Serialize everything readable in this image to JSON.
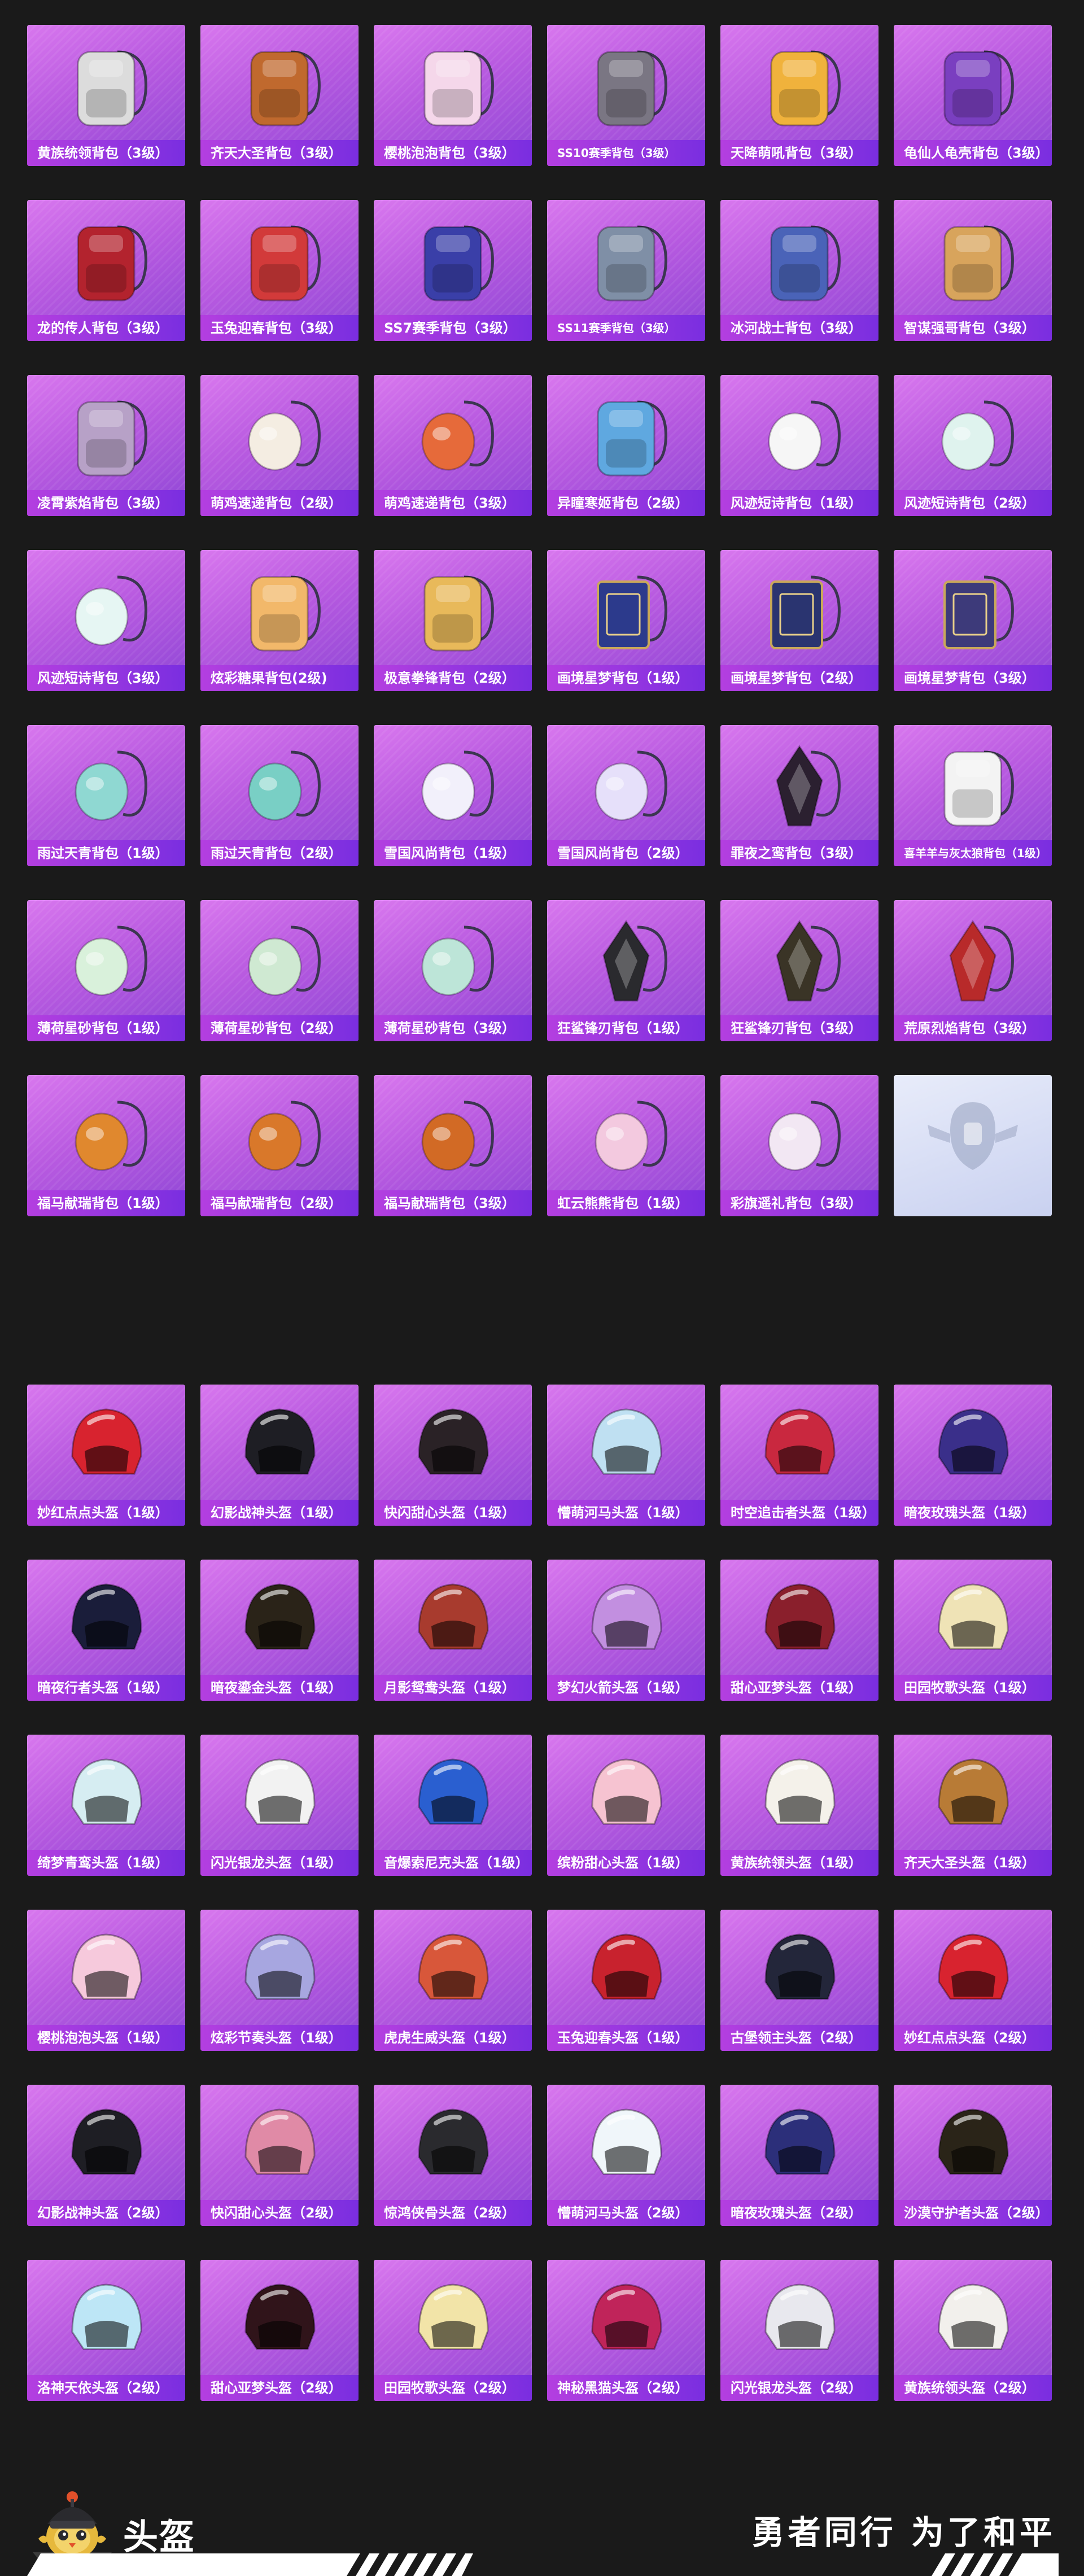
{
  "backpacks": [
    {
      "name": "黄族统领背包（3级）",
      "icon": "backpack-ornate-silver-icon",
      "color": "#dcdcdc"
    },
    {
      "name": "齐天大圣背包（3级）",
      "icon": "backpack-monkey-king-icon",
      "color": "#c0692e"
    },
    {
      "name": "樱桃泡泡背包（3级）",
      "icon": "backpack-bow-icon",
      "color": "#f5d7ea"
    },
    {
      "name": "SS10赛季背包（3级）",
      "icon": "backpack-icon",
      "color": "#7a7683"
    },
    {
      "name": "天降萌吼背包（3级）",
      "icon": "backpack-icon",
      "color": "#f0b23c"
    },
    {
      "name": "龟仙人龟壳背包（3级）",
      "icon": "backpack-turtle-shell-icon",
      "color": "#7a3fc0"
    },
    {
      "name": "龙的传人背包（3级）",
      "icon": "backpack-icon",
      "color": "#b3232e"
    },
    {
      "name": "玉兔迎春背包（3级）",
      "icon": "backpack-icon",
      "color": "#d23a3a"
    },
    {
      "name": "SS7赛季背包（3级）",
      "icon": "backpack-icon",
      "color": "#3a3fa8"
    },
    {
      "name": "SS11赛季背包（3级）",
      "icon": "backpack-icon",
      "color": "#7f8fa6"
    },
    {
      "name": "冰河战士背包（3级）",
      "icon": "backpack-icon",
      "color": "#4a63b8"
    },
    {
      "name": "智谋强哥背包（3级）",
      "icon": "backpack-plush-icon",
      "color": "#d8a45c"
    },
    {
      "name": "凌霄紫焰背包（3级）",
      "icon": "backpack-ornate-icon",
      "color": "#b7a1c7"
    },
    {
      "name": "萌鸡速递背包（2级）",
      "icon": "backpack-chick-icon",
      "color": "#f4ede2"
    },
    {
      "name": "萌鸡速递背包（3级）",
      "icon": "backpack-chick-icon",
      "color": "#e66a3a"
    },
    {
      "name": "异瞳寒姬背包（2级）",
      "icon": "backpack-plush-icon",
      "color": "#5fa8e0"
    },
    {
      "name": "风迹短诗背包（1级）",
      "icon": "backpack-sling-icon",
      "color": "#f6f6f6"
    },
    {
      "name": "风迹短诗背包（2级）",
      "icon": "backpack-sling-icon",
      "color": "#dff3ee"
    },
    {
      "name": "风迹短诗背包（3级）",
      "icon": "backpack-sling-icon",
      "color": "#e6f6f3"
    },
    {
      "name": "炫彩糖果背包(2级)",
      "icon": "backpack-candy-icon",
      "color": "#f2b86a"
    },
    {
      "name": "极意拳锋背包（2级）",
      "icon": "backpack-icon",
      "color": "#e8b95a"
    },
    {
      "name": "画境星梦背包（1级）",
      "icon": "backpack-book-icon",
      "color": "#2c3a8c"
    },
    {
      "name": "画境星梦背包（2级）",
      "icon": "backpack-book-icon",
      "color": "#2a3470"
    },
    {
      "name": "画境星梦背包（3级）",
      "icon": "backpack-book-icon",
      "color": "#3d3a7a"
    },
    {
      "name": "雨过天青背包（1级）",
      "icon": "backpack-sling-icon",
      "color": "#8fd8d2"
    },
    {
      "name": "雨过天青背包（2级）",
      "icon": "backpack-sling-icon",
      "color": "#79cfc5"
    },
    {
      "name": "雪国风尚背包（1级）",
      "icon": "backpack-snowball-icon",
      "color": "#f2f0fb"
    },
    {
      "name": "雪国风尚背包（2级）",
      "icon": "backpack-snowball-icon",
      "color": "#e6e0fa"
    },
    {
      "name": "罪夜之鸾背包（3级）",
      "icon": "backpack-dark-bird-icon",
      "color": "#2b2030"
    },
    {
      "name": "喜羊羊与灰太狼背包（1级）",
      "icon": "backpack-plush-icon",
      "color": "#f3f3f3"
    },
    {
      "name": "薄荷星砂背包（1级）",
      "icon": "backpack-sling-icon",
      "color": "#d9f1db"
    },
    {
      "name": "薄荷星砂背包（2级）",
      "icon": "backpack-sling-icon",
      "color": "#cfe9d2"
    },
    {
      "name": "薄荷星砂背包（3级）",
      "icon": "backpack-sling-icon",
      "color": "#bde5d8"
    },
    {
      "name": "狂鲨锋刃背包（1级）",
      "icon": "backpack-shark-icon",
      "color": "#2a2a2e"
    },
    {
      "name": "狂鲨锋刃背包（3级）",
      "icon": "backpack-shark-icon",
      "color": "#3a3426"
    },
    {
      "name": "荒原烈焰背包（3级）",
      "icon": "backpack-flame-icon",
      "color": "#b82a2a"
    },
    {
      "name": "福马献瑞背包（1级）",
      "icon": "backpack-horse-icon",
      "color": "#e0882e"
    },
    {
      "name": "福马献瑞背包（2级）",
      "icon": "backpack-horse-icon",
      "color": "#d9782a"
    },
    {
      "name": "福马献瑞背包（3级）",
      "icon": "backpack-horse-icon",
      "color": "#d26a25"
    },
    {
      "name": "虹云熊熊背包（1级）",
      "icon": "backpack-cloud-bear-icon",
      "color": "#f3c9df"
    },
    {
      "name": "彩旗遥礼背包（3级）",
      "icon": "backpack-sling-icon",
      "color": "#f2e7f3"
    },
    {
      "name": "",
      "icon": "placeholder-emblem-icon",
      "color": "#c5cde8",
      "placeholder": true
    }
  ],
  "helmet_section": {
    "title": "头盔",
    "slogan": "勇者同行 为了和平",
    "mascot_icon": "chicken-knight-mascot-icon"
  },
  "helmets": [
    {
      "name": "妙红点点头盔（1级）",
      "icon": "helmet-icon",
      "color": "#d8232f"
    },
    {
      "name": "幻影战神头盔（1级）",
      "icon": "helmet-icon",
      "color": "#1e1e24"
    },
    {
      "name": "快闪甜心头盔（1级）",
      "icon": "helmet-icon",
      "color": "#2a2226"
    },
    {
      "name": "懵萌河马头盔（1级）",
      "icon": "helmet-icon",
      "color": "#bfe0f2"
    },
    {
      "name": "时空追击者头盔（1级）",
      "icon": "helmet-icon",
      "color": "#c9283f"
    },
    {
      "name": "暗夜玫瑰头盔（1级）",
      "icon": "helmet-icon",
      "color": "#3a2f8a"
    },
    {
      "name": "暗夜行者头盔（1级）",
      "icon": "helmet-icon",
      "color": "#1a1d3a"
    },
    {
      "name": "暗夜鎏金头盔（1级）",
      "icon": "helmet-icon",
      "color": "#2a2318"
    },
    {
      "name": "月影鸳鸯头盔（1级）",
      "icon": "helmet-icon",
      "color": "#a83b2e"
    },
    {
      "name": "梦幻火箭头盔（1级）",
      "icon": "helmet-icon",
      "color": "#c28fe0"
    },
    {
      "name": "甜心亚梦头盔（1级）",
      "icon": "helmet-icon",
      "color": "#8a1f2c"
    },
    {
      "name": "田园牧歌头盔（1级）",
      "icon": "helmet-icon",
      "color": "#efe3b6"
    },
    {
      "name": "绮梦青鸾头盔（1级）",
      "icon": "helmet-icon",
      "color": "#d6edf2"
    },
    {
      "name": "闪光银龙头盔（1级）",
      "icon": "helmet-icon",
      "color": "#f2f2f2"
    },
    {
      "name": "音爆索尼克头盔（1级）",
      "icon": "helmet-icon",
      "color": "#2a5fd0"
    },
    {
      "name": "缤粉甜心头盔（1级）",
      "icon": "helmet-icon",
      "color": "#f6c3d1"
    },
    {
      "name": "黄族统领头盔（1级）",
      "icon": "helmet-icon",
      "color": "#f4f1ea"
    },
    {
      "name": "齐天大圣头盔（1级）",
      "icon": "helmet-icon",
      "color": "#b87b36"
    },
    {
      "name": "樱桃泡泡头盔（1级）",
      "icon": "helmet-icon",
      "color": "#f6c9dc"
    },
    {
      "name": "炫彩节奏头盔（1级）",
      "icon": "helmet-icon",
      "color": "#a7a6e0"
    },
    {
      "name": "虎虎生威头盔（1级）",
      "icon": "helmet-icon",
      "color": "#d8573a"
    },
    {
      "name": "玉兔迎春头盔（1级）",
      "icon": "helmet-icon",
      "color": "#c8222e"
    },
    {
      "name": "古堡领主头盔（2级）",
      "icon": "helmet-icon",
      "color": "#23263a"
    },
    {
      "name": "妙红点点头盔（2级）",
      "icon": "helmet-icon",
      "color": "#d8232f"
    },
    {
      "name": "幻影战神头盔（2级）",
      "icon": "helmet-icon",
      "color": "#1e1e24"
    },
    {
      "name": "快闪甜心头盔（2级）",
      "icon": "helmet-icon",
      "color": "#e08aa6"
    },
    {
      "name": "惊鸿侠骨头盔（2级）",
      "icon": "helmet-icon",
      "color": "#2a2a2e"
    },
    {
      "name": "懵萌河马头盔（2级）",
      "icon": "helmet-icon",
      "color": "#f0f6fa"
    },
    {
      "name": "暗夜玫瑰头盔（2级）",
      "icon": "helmet-icon",
      "color": "#2c2f7a"
    },
    {
      "name": "沙漠守护者头盔（2级）",
      "icon": "helmet-icon",
      "color": "#2a2418"
    },
    {
      "name": "洛神天依头盔（2级）",
      "icon": "helmet-icon",
      "color": "#bde6f6"
    },
    {
      "name": "甜心亚梦头盔（2级）",
      "icon": "helmet-icon",
      "color": "#30141a"
    },
    {
      "name": "田园牧歌头盔（2级）",
      "icon": "helmet-icon",
      "color": "#f2e4a8"
    },
    {
      "name": "神秘黑猫头盔（2级）",
      "icon": "helmet-icon",
      "color": "#c0245a"
    },
    {
      "name": "闪光银龙头盔（2级）",
      "icon": "helmet-icon",
      "color": "#e8e8ee"
    },
    {
      "name": "黄族统领头盔（2级）",
      "icon": "helmet-icon",
      "color": "#f2f0ec"
    }
  ]
}
